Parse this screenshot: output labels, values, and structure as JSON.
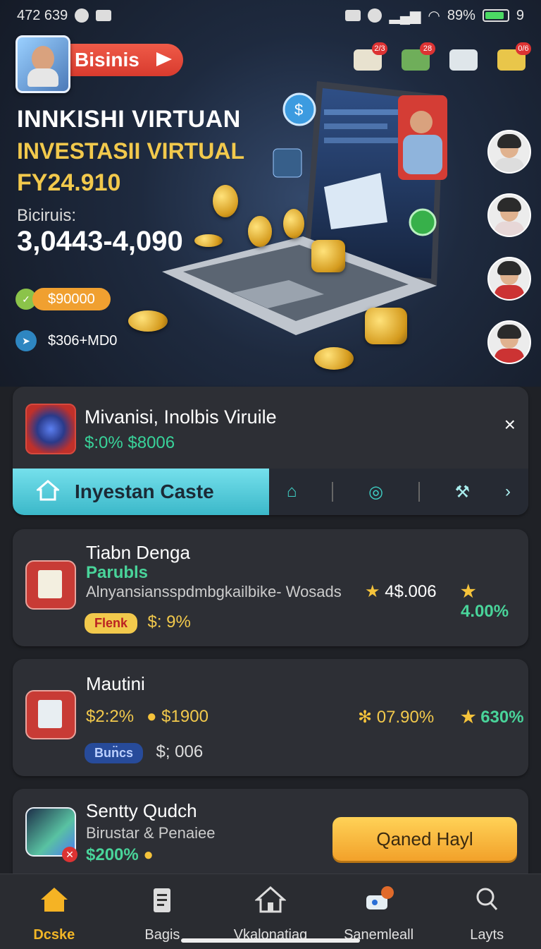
{
  "status_bar": {
    "time": "472 639",
    "battery": "89%",
    "signal_extra": "9"
  },
  "header": {
    "business_pill": "Bisinis",
    "title_line1": "INNKISHI VIRTUAN",
    "title_line2": "INVESTASII VIRTUAL",
    "title_line3": "FY24.910",
    "label": "Biciruis:",
    "amount_range": "3,0443-4,090",
    "pill_amount": "$90000",
    "secondary_amount": "$306+MD0",
    "top_icon_badges": [
      "2/3",
      "28",
      "",
      "0/6"
    ]
  },
  "notification": {
    "title": "Mivanisi, Inolbis Viruile",
    "subtitle": "$:0% $8006",
    "close": "×",
    "active_tab": "Inyestan Caste"
  },
  "items": [
    {
      "name": "Tiabn Denga",
      "tag": "Parubls",
      "desc": "Alnyansiansspdmbgkailbike- Wosads",
      "stat1": "4$.006",
      "stat2": "4.00%",
      "badge": "Flenk",
      "extra": "$: 9%"
    },
    {
      "name": "Mautini",
      "line": "$2:2%",
      "coin_value": "$1900",
      "stat1": "07.90%",
      "stat2": "630%",
      "badge": "Bun̈cs",
      "extra": "$; 006"
    },
    {
      "name": "Sentty Qudch",
      "desc": "Birustar & Penaiee",
      "value": "$200%",
      "cta": "Qaned Hayl"
    }
  ],
  "bottom_nav": [
    {
      "label": "Dcske",
      "icon": "home-icon",
      "active": true
    },
    {
      "label": "Bagis",
      "icon": "clipboard-icon",
      "active": false
    },
    {
      "label": "Vkalonatiag",
      "icon": "house-outline-icon",
      "active": false
    },
    {
      "label": "Sanemleall",
      "icon": "robot-icon",
      "active": false
    },
    {
      "label": "Layts",
      "icon": "search-icon",
      "active": false
    }
  ],
  "colors": {
    "accent_gold": "#f2c94c",
    "accent_green": "#49d49a",
    "accent_cyan": "#3bb8c9",
    "accent_red": "#d83b2e"
  }
}
